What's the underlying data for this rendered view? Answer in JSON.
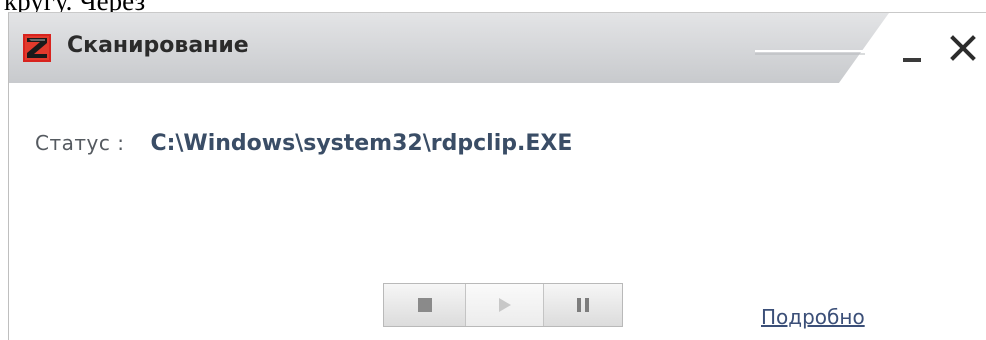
{
  "document": {
    "text_above": "кругу. Через"
  },
  "window": {
    "title": "Сканирование",
    "icons": {
      "app": "scanner-app-icon",
      "minimize": "minimize-icon",
      "close": "close-icon"
    }
  },
  "status": {
    "label": "Статус :",
    "value": "C:\\Windows\\system32\\rdpclip.EXE"
  },
  "controls": {
    "stop": "stop-icon",
    "play": "play-icon",
    "pause": "pause-icon"
  },
  "details_link": "Подробно",
  "colors": {
    "titlebar": "#d3d5d8",
    "icon_red": "#d8231e",
    "status_value": "#3a4d66",
    "link": "#3b4f78"
  }
}
